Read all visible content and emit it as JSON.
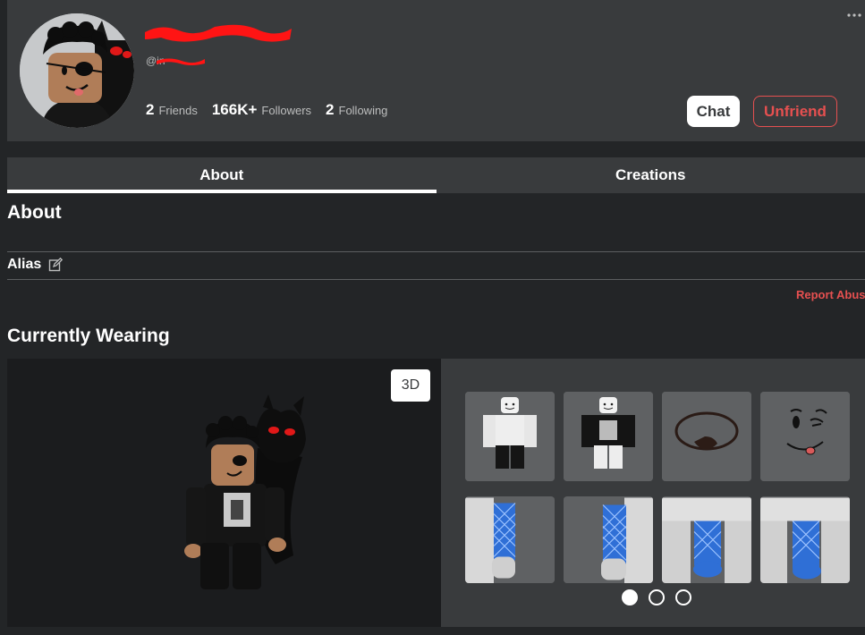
{
  "profile": {
    "display_name": "in",
    "handle": "@in",
    "stats": [
      {
        "count": "2",
        "label": "Friends"
      },
      {
        "count": "166K+",
        "label": "Followers"
      },
      {
        "count": "2",
        "label": "Following"
      }
    ],
    "more_icon": "ellipsis-icon",
    "chat_label": "Chat",
    "unfriend_label": "Unfriend"
  },
  "tabs": [
    {
      "label": "About",
      "active": true
    },
    {
      "label": "Creations",
      "active": false
    }
  ],
  "about": {
    "title": "About",
    "alias_label": "Alias",
    "edit_icon": "edit-icon",
    "report_label": "Report Abuse"
  },
  "wearing": {
    "title": "Currently Wearing",
    "view_toggle_label": "3D",
    "items": [
      {
        "name": "white-outfit-item"
      },
      {
        "name": "black-shirt-item"
      },
      {
        "name": "eyepatch-item"
      },
      {
        "name": "face-item"
      },
      {
        "name": "left-arm-item"
      },
      {
        "name": "right-arm-item"
      },
      {
        "name": "left-leg-item"
      },
      {
        "name": "right-leg-item"
      }
    ],
    "pager": {
      "pages": 3,
      "current": 1
    }
  },
  "colors": {
    "accent_red": "#e65050",
    "panel": "#393b3d",
    "background": "#232527"
  }
}
